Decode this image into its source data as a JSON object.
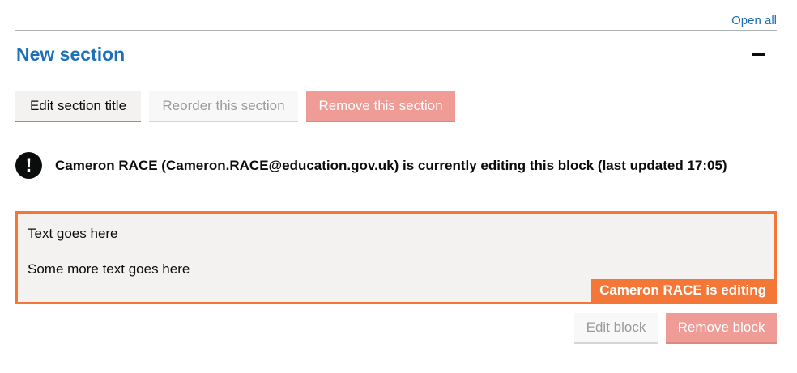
{
  "header": {
    "open_all": "Open all"
  },
  "section": {
    "title": "New section",
    "buttons": {
      "edit_title": "Edit section title",
      "reorder": "Reorder this section",
      "remove": "Remove this section"
    }
  },
  "warning": {
    "icon": "!",
    "text": "Cameron RACE (Cameron.RACE@education.gov.uk) is currently editing this block (last updated 17:05)"
  },
  "block": {
    "lines": [
      "Text goes here",
      "Some more text goes here"
    ],
    "editing_tag": "Cameron RACE is editing",
    "buttons": {
      "edit": "Edit block",
      "remove": "Remove block"
    }
  },
  "colors": {
    "link": "#1d70b8",
    "editing_accent": "#f47738",
    "danger_disabled": "#ee9c95"
  }
}
